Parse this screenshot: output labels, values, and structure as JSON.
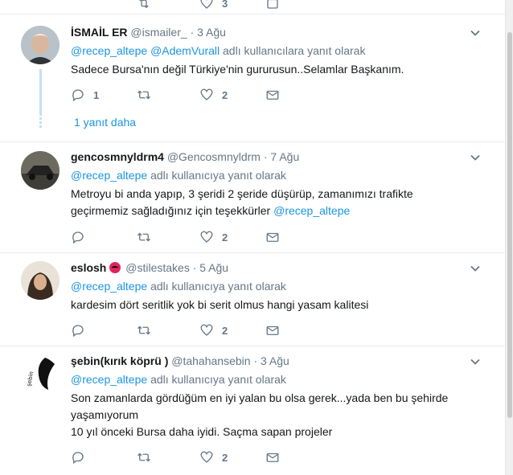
{
  "colors": {
    "link": "#1b95e0",
    "muted": "#657786",
    "text": "#14171a",
    "border": "#e6ecf0",
    "thread": "#c4dff6"
  },
  "top_partial": {
    "count_text": "3"
  },
  "tweets": [
    {
      "fullname": "İSMAİL ER",
      "username": "@ismailer_",
      "sep": "·",
      "time": "3 Ağu",
      "mention_1": "@recep_altepe",
      "mention_2": "@AdemVurall",
      "reply_suffix": "adlı kullanıcılara yanıt olarak",
      "text": "Sadece Bursa'nın değil Türkiye'nin gururusun..Selamlar Başkanım.",
      "reply_count": "1",
      "retweet_count": "",
      "like_count": "2",
      "more_replies": "1 yanıt daha"
    },
    {
      "fullname": "gencosmnyldrm4",
      "username": "@Gencosmnyldrm",
      "sep": "·",
      "time": "7 Ağu",
      "mention_1": "@recep_altepe",
      "reply_suffix": "adlı kullanıcıya yanıt olarak",
      "text": "Metroyu bi anda yapıp, 3 şeridi 2 şeride düşürüp, zamanımızı trafikte geçirmemiz sağladığınız için teşekkürler",
      "text_mention": "@recep_altepe",
      "reply_count": "",
      "retweet_count": "",
      "like_count": "2"
    },
    {
      "fullname": "eslosh",
      "username": "@stilestakes",
      "sep": "·",
      "time": "5 Ağu",
      "badge_icon": "angry-face-emoji",
      "mention_1": "@recep_altepe",
      "reply_suffix": "adlı kullanıcıya yanıt olarak",
      "text": "kardesim dört seritlik yok bi serit olmus hangi yasam kalitesi",
      "reply_count": "",
      "retweet_count": "",
      "like_count": "2"
    },
    {
      "fullname": "şebin(kırık köprü )",
      "username": "@tahahansebin",
      "sep": "·",
      "time": "3 Ağu",
      "mention_1": "@recep_altepe",
      "reply_suffix": "adlı kullanıcıya yanıt olarak",
      "text_line_1": "Son zamanlarda gördüğüm en iyi yalan bu olsa gerek...yada ben bu şehirde yaşamıyorum",
      "text_line_2": "10 yıl önceki Bursa daha iyidi. Saçma sapan projeler",
      "reply_count": "",
      "retweet_count": "",
      "like_count": "2",
      "avatar_text": "şebin"
    }
  ]
}
